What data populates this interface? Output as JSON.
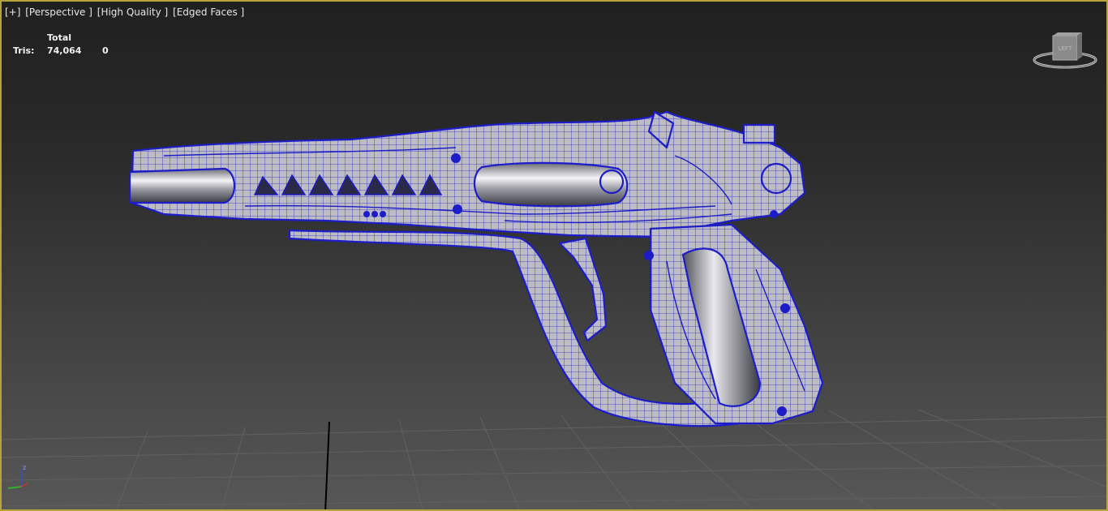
{
  "viewport": {
    "label_parts": [
      "[+]",
      "[Perspective ]",
      "[High Quality ]",
      "[Edged Faces ]"
    ],
    "border_color": "#b8a23c"
  },
  "stats": {
    "header": "Total",
    "row_label": "Tris:",
    "total": "74,064",
    "selected": "0"
  },
  "viewcube": {
    "face_label": "LEFT",
    "icon": "viewcube-icon"
  },
  "axis_tripod": {
    "z_label": "z",
    "icon": "axis-tripod-icon"
  },
  "model": {
    "wire_color": "#1c1cc8",
    "shade_color": "#b9b9bf"
  }
}
